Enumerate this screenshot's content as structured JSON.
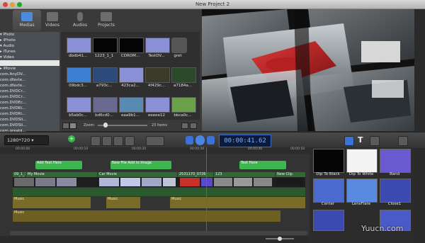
{
  "window": {
    "title": "New Project 2"
  },
  "tabs": [
    {
      "label": "Medias",
      "active": true
    },
    {
      "label": "Videos",
      "active": false
    },
    {
      "label": "Audios",
      "active": false
    },
    {
      "label": "Projects",
      "active": false
    }
  ],
  "sidebar": {
    "items": [
      {
        "label": "▾ Photo",
        "selected": false
      },
      {
        "label": "  ▸ iPhoto",
        "selected": false
      },
      {
        "label": "▾ Audio",
        "selected": false
      },
      {
        "label": "  ▸ iTunes",
        "selected": false
      },
      {
        "label": "▾ Video",
        "selected": false
      },
      {
        "label": "",
        "selected": true
      },
      {
        "label": "  ▸ iMovie",
        "selected": false
      },
      {
        "label": "   com.AnyDV...",
        "selected": false
      },
      {
        "label": "   com.dfavte...",
        "selected": false
      },
      {
        "label": "   com.dfavte...",
        "selected": false
      },
      {
        "label": "   com.DVDCr...",
        "selected": false
      },
      {
        "label": "   com.DVDCr...",
        "selected": false
      },
      {
        "label": "   com.DVDEc...",
        "selected": false
      },
      {
        "label": "   com.DVDRi...",
        "selected": false
      },
      {
        "label": "   com.DVDRi...",
        "selected": false
      },
      {
        "label": "   com.DVDSli...",
        "selected": false
      },
      {
        "label": "   com.DVDSli...",
        "selected": false
      },
      {
        "label": "   com.greatd...",
        "selected": false
      },
      {
        "label": "   com.greatd...",
        "selected": false
      }
    ]
  },
  "media": {
    "items": [
      {
        "label": "dbdb41...",
        "color": "#8a8fd6"
      },
      {
        "label": "1223_1_1",
        "color": "#050505"
      },
      {
        "label": "CDROM...",
        "color": "#050505"
      },
      {
        "label": "TestDV...",
        "color": "#8a8fd6"
      },
      {
        "label": "gret",
        "color": "#555555"
      },
      {
        "label": "09bdc3...",
        "color": "#3d7fd0"
      },
      {
        "label": "a793c...",
        "color": "#2c4a7a"
      },
      {
        "label": "423ca2...",
        "color": "#8a8fd6"
      },
      {
        "label": "4f429c...",
        "color": "#3a3a2a"
      },
      {
        "label": "a7184a...",
        "color": "#2a4a2a"
      },
      {
        "label": "b5ab0c...",
        "color": "#8a8fd6"
      },
      {
        "label": "bd6cd0...",
        "color": "#6a6a90"
      },
      {
        "label": "eaa9b1...",
        "color": "#5a8ab0"
      },
      {
        "label": "eeeee12",
        "color": "#8a8fd6"
      },
      {
        "label": "bbca0c...",
        "color": "#6aa04a"
      }
    ],
    "zoom_label": "Zoom:",
    "count_label": "23 Items"
  },
  "toolbar": {
    "resolution": "1280*720",
    "timecode": "00:00:41.62"
  },
  "timeline": {
    "ruler_ticks": [
      "00:00:00",
      "00:00:10",
      "00:00:20",
      "00:00:30",
      "00:00:40",
      "00:00:50"
    ],
    "text_clips": [
      "Add Text Here",
      "New File Add to Image",
      "Text Here"
    ],
    "video_labels": [
      "09_1_1",
      "My Movie",
      "Car Movie",
      "2531170_0726",
      "123",
      "New Clip"
    ],
    "audio_labels": [
      "Music",
      "Music",
      "Music",
      "Music"
    ]
  },
  "transitions": [
    {
      "label": "Dip To Black",
      "color": "#050505"
    },
    {
      "label": "Dip To White",
      "color": "#f4f4f4"
    },
    {
      "label": "Band",
      "color": "#6a5ad0"
    },
    {
      "label": "Center",
      "color": "#4a6ad0"
    },
    {
      "label": "LensFlare",
      "color": "#5a8ae0"
    },
    {
      "label": "Close1",
      "color": "#3a4ab0"
    }
  ],
  "watermark": "Yuucn.com"
}
